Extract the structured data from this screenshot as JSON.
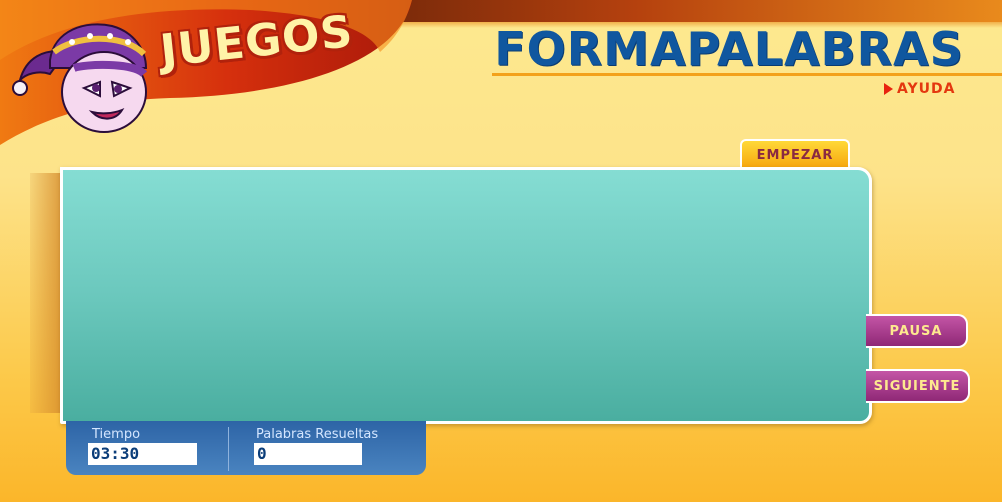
{
  "header": {
    "section_label": "JUEGOS",
    "game_title": "FORMAPALABRAS",
    "help_label": "AYUDA"
  },
  "controls": {
    "start_label": "EMPEZAR",
    "pause_label": "PAUSA",
    "next_label": "SIGUIENTE"
  },
  "status": {
    "time_label": "Tiempo",
    "time_value": "03:30",
    "solved_label": "Palabras Resueltas",
    "solved_value": "0"
  },
  "colors": {
    "title_blue": "#10579f",
    "board_teal": "#6bc8bd",
    "button_magenta": "#a83a8e",
    "start_yellow": "#ffd938",
    "status_blue": "#2d64a6"
  },
  "icons": {
    "help_arrow": "triangle-right-icon",
    "mascot": "jester-mascot"
  }
}
